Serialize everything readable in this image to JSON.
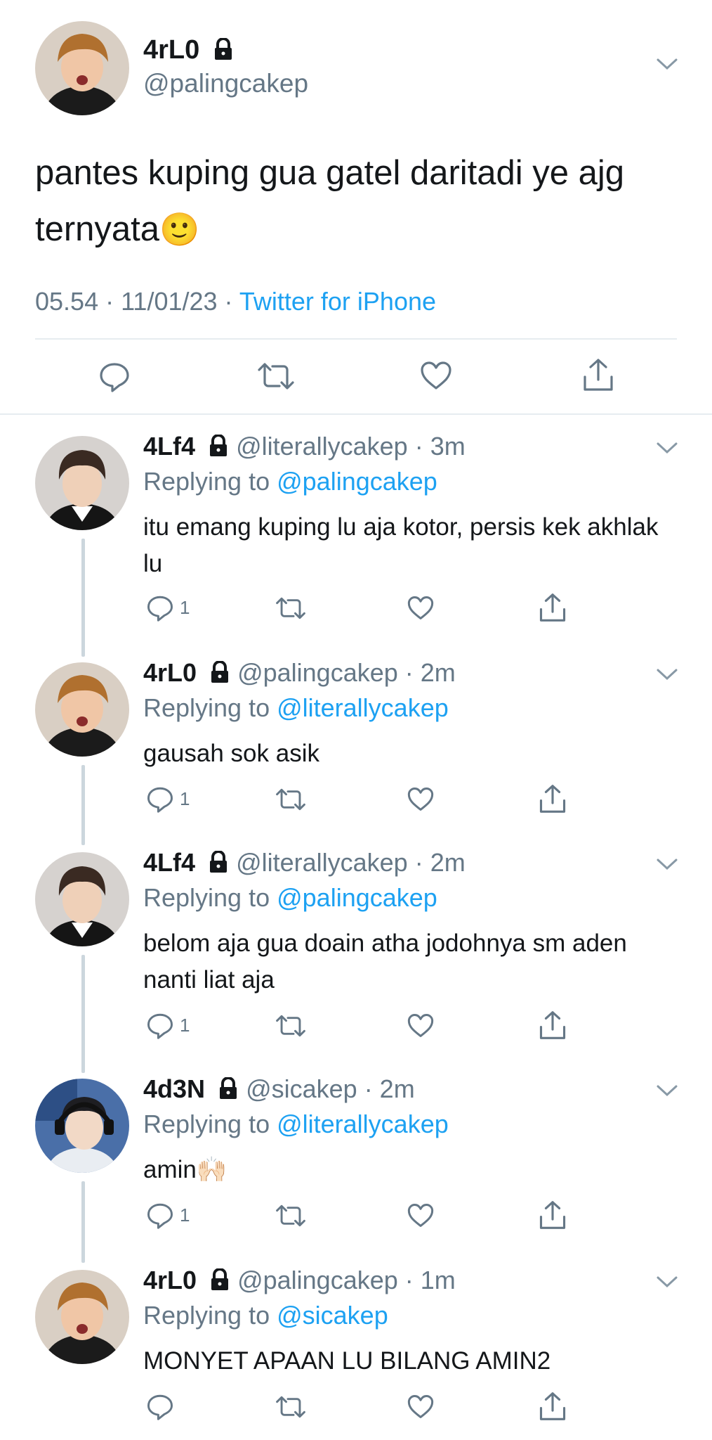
{
  "main_tweet": {
    "name": "4rL0",
    "handle": "@palingcakep",
    "text_line1": "pantes kuping gua gatel daritadi ye ajg",
    "text_line2": "ternyata",
    "emoji": "🙂",
    "time": "05.54 · 11/01/23 · ",
    "source": "Twitter for iPhone"
  },
  "replies": [
    {
      "name": "4Lf4",
      "handle": "@literallycakep",
      "time": "· 3m",
      "replying_label": "Replying to ",
      "replying_to": "@palingcakep",
      "text": "itu emang kuping lu aja kotor, persis kek akhlak lu",
      "reply_count": "1"
    },
    {
      "name": "4rL0",
      "handle": "@palingcakep",
      "time": "· 2m",
      "replying_label": "Replying to ",
      "replying_to": "@literallycakep",
      "text": "gausah sok asik",
      "reply_count": "1"
    },
    {
      "name": "4Lf4",
      "handle": "@literallycakep",
      "time": "· 2m",
      "replying_label": "Replying to ",
      "replying_to": "@palingcakep",
      "text": "belom aja gua doain atha jodohnya sm aden nanti liat aja",
      "reply_count": "1"
    },
    {
      "name": "4d3N",
      "handle": "@sicakep",
      "time": "· 2m",
      "replying_label": "Replying to ",
      "replying_to": "@literallycakep",
      "text": "amin🙌🏻",
      "reply_count": "1"
    },
    {
      "name": "4rL0",
      "handle": "@palingcakep",
      "time": "· 1m",
      "replying_label": "Replying to ",
      "replying_to": "@sicakep",
      "text": "MONYET APAAN LU BILANG AMIN2",
      "reply_count": ""
    }
  ],
  "colors": {
    "accent": "#1da1f2",
    "muted": "#657786",
    "divider": "#e6ecf0",
    "thread_line": "#ccd6dd"
  },
  "icons": [
    "lock-icon",
    "chevron-down-icon",
    "reply-icon",
    "retweet-icon",
    "like-icon",
    "share-icon"
  ]
}
